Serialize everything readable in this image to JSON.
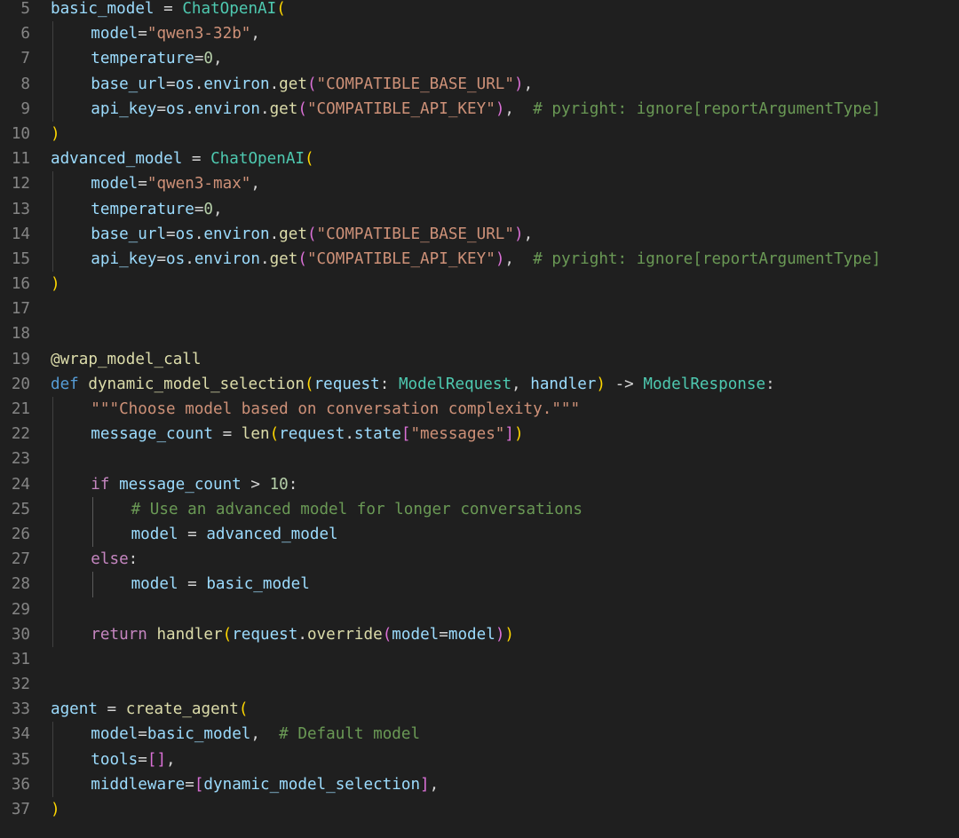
{
  "editor": {
    "language": "python",
    "theme_colors": {
      "background": "#1f1f1f",
      "line_number": "#858585",
      "variable": "#9cdcfe",
      "string": "#ce9178",
      "number": "#b5cea8",
      "function": "#dcdcaa",
      "class": "#4ec9b0",
      "keyword": "#569cd6",
      "control": "#c586c0",
      "comment": "#6a9955",
      "bracket_1": "#ffd700",
      "bracket_2": "#da70d6",
      "bracket_3": "#179fff"
    },
    "lines": [
      {
        "num": "5",
        "indent": 0,
        "tokens": [
          [
            "basic_model",
            "v"
          ],
          [
            " = ",
            "p"
          ],
          [
            "ChatOpenAI",
            "c"
          ],
          [
            "(",
            "b1"
          ]
        ]
      },
      {
        "num": "6",
        "indent": 1,
        "tokens": [
          [
            "model",
            "v"
          ],
          [
            "=",
            "p"
          ],
          [
            "\"qwen3-32b\"",
            "s"
          ],
          [
            ",",
            "p"
          ]
        ]
      },
      {
        "num": "7",
        "indent": 1,
        "tokens": [
          [
            "temperature",
            "v"
          ],
          [
            "=",
            "p"
          ],
          [
            "0",
            "n"
          ],
          [
            ",",
            "p"
          ]
        ]
      },
      {
        "num": "8",
        "indent": 1,
        "tokens": [
          [
            "base_url",
            "v"
          ],
          [
            "=",
            "p"
          ],
          [
            "os",
            "v"
          ],
          [
            ".",
            "p"
          ],
          [
            "environ",
            "v"
          ],
          [
            ".",
            "p"
          ],
          [
            "get",
            "f"
          ],
          [
            "(",
            "b2"
          ],
          [
            "\"COMPATIBLE_BASE_URL\"",
            "s"
          ],
          [
            ")",
            "b2"
          ],
          [
            ",",
            "p"
          ]
        ]
      },
      {
        "num": "9",
        "indent": 1,
        "tokens": [
          [
            "api_key",
            "v"
          ],
          [
            "=",
            "p"
          ],
          [
            "os",
            "v"
          ],
          [
            ".",
            "p"
          ],
          [
            "environ",
            "v"
          ],
          [
            ".",
            "p"
          ],
          [
            "get",
            "f"
          ],
          [
            "(",
            "b2"
          ],
          [
            "\"COMPATIBLE_API_KEY\"",
            "s"
          ],
          [
            ")",
            "b2"
          ],
          [
            ",  ",
            "p"
          ],
          [
            "# pyright: ignore[reportArgumentType]",
            "cm"
          ]
        ]
      },
      {
        "num": "10",
        "indent": 0,
        "tokens": [
          [
            ")",
            "b1"
          ]
        ]
      },
      {
        "num": "11",
        "indent": 0,
        "tokens": [
          [
            "advanced_model",
            "v"
          ],
          [
            " = ",
            "p"
          ],
          [
            "ChatOpenAI",
            "c"
          ],
          [
            "(",
            "b1"
          ]
        ]
      },
      {
        "num": "12",
        "indent": 1,
        "tokens": [
          [
            "model",
            "v"
          ],
          [
            "=",
            "p"
          ],
          [
            "\"qwen3-max\"",
            "s"
          ],
          [
            ",",
            "p"
          ]
        ]
      },
      {
        "num": "13",
        "indent": 1,
        "tokens": [
          [
            "temperature",
            "v"
          ],
          [
            "=",
            "p"
          ],
          [
            "0",
            "n"
          ],
          [
            ",",
            "p"
          ]
        ]
      },
      {
        "num": "14",
        "indent": 1,
        "tokens": [
          [
            "base_url",
            "v"
          ],
          [
            "=",
            "p"
          ],
          [
            "os",
            "v"
          ],
          [
            ".",
            "p"
          ],
          [
            "environ",
            "v"
          ],
          [
            ".",
            "p"
          ],
          [
            "get",
            "f"
          ],
          [
            "(",
            "b2"
          ],
          [
            "\"COMPATIBLE_BASE_URL\"",
            "s"
          ],
          [
            ")",
            "b2"
          ],
          [
            ",",
            "p"
          ]
        ]
      },
      {
        "num": "15",
        "indent": 1,
        "tokens": [
          [
            "api_key",
            "v"
          ],
          [
            "=",
            "p"
          ],
          [
            "os",
            "v"
          ],
          [
            ".",
            "p"
          ],
          [
            "environ",
            "v"
          ],
          [
            ".",
            "p"
          ],
          [
            "get",
            "f"
          ],
          [
            "(",
            "b2"
          ],
          [
            "\"COMPATIBLE_API_KEY\"",
            "s"
          ],
          [
            ")",
            "b2"
          ],
          [
            ",  ",
            "p"
          ],
          [
            "# pyright: ignore[reportArgumentType]",
            "cm"
          ]
        ]
      },
      {
        "num": "16",
        "indent": 0,
        "tokens": [
          [
            ")",
            "b1"
          ]
        ]
      },
      {
        "num": "17",
        "indent": 0,
        "tokens": []
      },
      {
        "num": "18",
        "indent": 0,
        "tokens": []
      },
      {
        "num": "19",
        "indent": 0,
        "tokens": [
          [
            "@wrap_model_call",
            "f"
          ]
        ]
      },
      {
        "num": "20",
        "indent": 0,
        "tokens": [
          [
            "def",
            "k"
          ],
          [
            " ",
            "p"
          ],
          [
            "dynamic_model_selection",
            "f"
          ],
          [
            "(",
            "b1"
          ],
          [
            "request",
            "v"
          ],
          [
            ": ",
            "p"
          ],
          [
            "ModelRequest",
            "c"
          ],
          [
            ", ",
            "p"
          ],
          [
            "handler",
            "v"
          ],
          [
            ")",
            "b1"
          ],
          [
            " -> ",
            "p"
          ],
          [
            "ModelResponse",
            "c"
          ],
          [
            ":",
            "p"
          ]
        ]
      },
      {
        "num": "21",
        "indent": 1,
        "tokens": [
          [
            "\"\"\"Choose model based on conversation complexity.\"\"\"",
            "s"
          ]
        ]
      },
      {
        "num": "22",
        "indent": 1,
        "tokens": [
          [
            "message_count",
            "v"
          ],
          [
            " = ",
            "p"
          ],
          [
            "len",
            "f"
          ],
          [
            "(",
            "b1"
          ],
          [
            "request",
            "v"
          ],
          [
            ".",
            "p"
          ],
          [
            "state",
            "v"
          ],
          [
            "[",
            "b2"
          ],
          [
            "\"messages\"",
            "s"
          ],
          [
            "]",
            "b2"
          ],
          [
            ")",
            "b1"
          ]
        ]
      },
      {
        "num": "23",
        "indent": 1,
        "tokens": []
      },
      {
        "num": "24",
        "indent": 1,
        "tokens": [
          [
            "if",
            "ctl"
          ],
          [
            " ",
            "p"
          ],
          [
            "message_count",
            "v"
          ],
          [
            " > ",
            "p"
          ],
          [
            "10",
            "n"
          ],
          [
            ":",
            "p"
          ]
        ]
      },
      {
        "num": "25",
        "indent": 2,
        "tokens": [
          [
            "# Use an advanced model for longer conversations",
            "cm"
          ]
        ]
      },
      {
        "num": "26",
        "indent": 2,
        "tokens": [
          [
            "model",
            "v"
          ],
          [
            " = ",
            "p"
          ],
          [
            "advanced_model",
            "v"
          ]
        ]
      },
      {
        "num": "27",
        "indent": 1,
        "tokens": [
          [
            "else",
            "ctl"
          ],
          [
            ":",
            "p"
          ]
        ]
      },
      {
        "num": "28",
        "indent": 2,
        "tokens": [
          [
            "model",
            "v"
          ],
          [
            " = ",
            "p"
          ],
          [
            "basic_model",
            "v"
          ]
        ]
      },
      {
        "num": "29",
        "indent": 1,
        "tokens": []
      },
      {
        "num": "30",
        "indent": 1,
        "tokens": [
          [
            "return",
            "ctl"
          ],
          [
            " ",
            "p"
          ],
          [
            "handler",
            "f"
          ],
          [
            "(",
            "b1"
          ],
          [
            "request",
            "v"
          ],
          [
            ".",
            "p"
          ],
          [
            "override",
            "f"
          ],
          [
            "(",
            "b2"
          ],
          [
            "model",
            "v"
          ],
          [
            "=",
            "p"
          ],
          [
            "model",
            "v"
          ],
          [
            ")",
            "b2"
          ],
          [
            ")",
            "b1"
          ]
        ]
      },
      {
        "num": "31",
        "indent": 0,
        "tokens": []
      },
      {
        "num": "32",
        "indent": 0,
        "tokens": []
      },
      {
        "num": "33",
        "indent": 0,
        "tokens": [
          [
            "agent",
            "v"
          ],
          [
            " = ",
            "p"
          ],
          [
            "create_agent",
            "f"
          ],
          [
            "(",
            "b1"
          ]
        ]
      },
      {
        "num": "34",
        "indent": 1,
        "tokens": [
          [
            "model",
            "v"
          ],
          [
            "=",
            "p"
          ],
          [
            "basic_model",
            "v"
          ],
          [
            ",  ",
            "p"
          ],
          [
            "# Default model",
            "cm"
          ]
        ]
      },
      {
        "num": "35",
        "indent": 1,
        "tokens": [
          [
            "tools",
            "v"
          ],
          [
            "=",
            "p"
          ],
          [
            "[]",
            "b2"
          ],
          [
            ",",
            "p"
          ]
        ]
      },
      {
        "num": "36",
        "indent": 1,
        "tokens": [
          [
            "middleware",
            "v"
          ],
          [
            "=",
            "p"
          ],
          [
            "[",
            "b2"
          ],
          [
            "dynamic_model_selection",
            "v"
          ],
          [
            "]",
            "b2"
          ],
          [
            ",",
            "p"
          ]
        ]
      },
      {
        "num": "37",
        "indent": 0,
        "tokens": [
          [
            ")",
            "b1"
          ]
        ]
      }
    ]
  }
}
